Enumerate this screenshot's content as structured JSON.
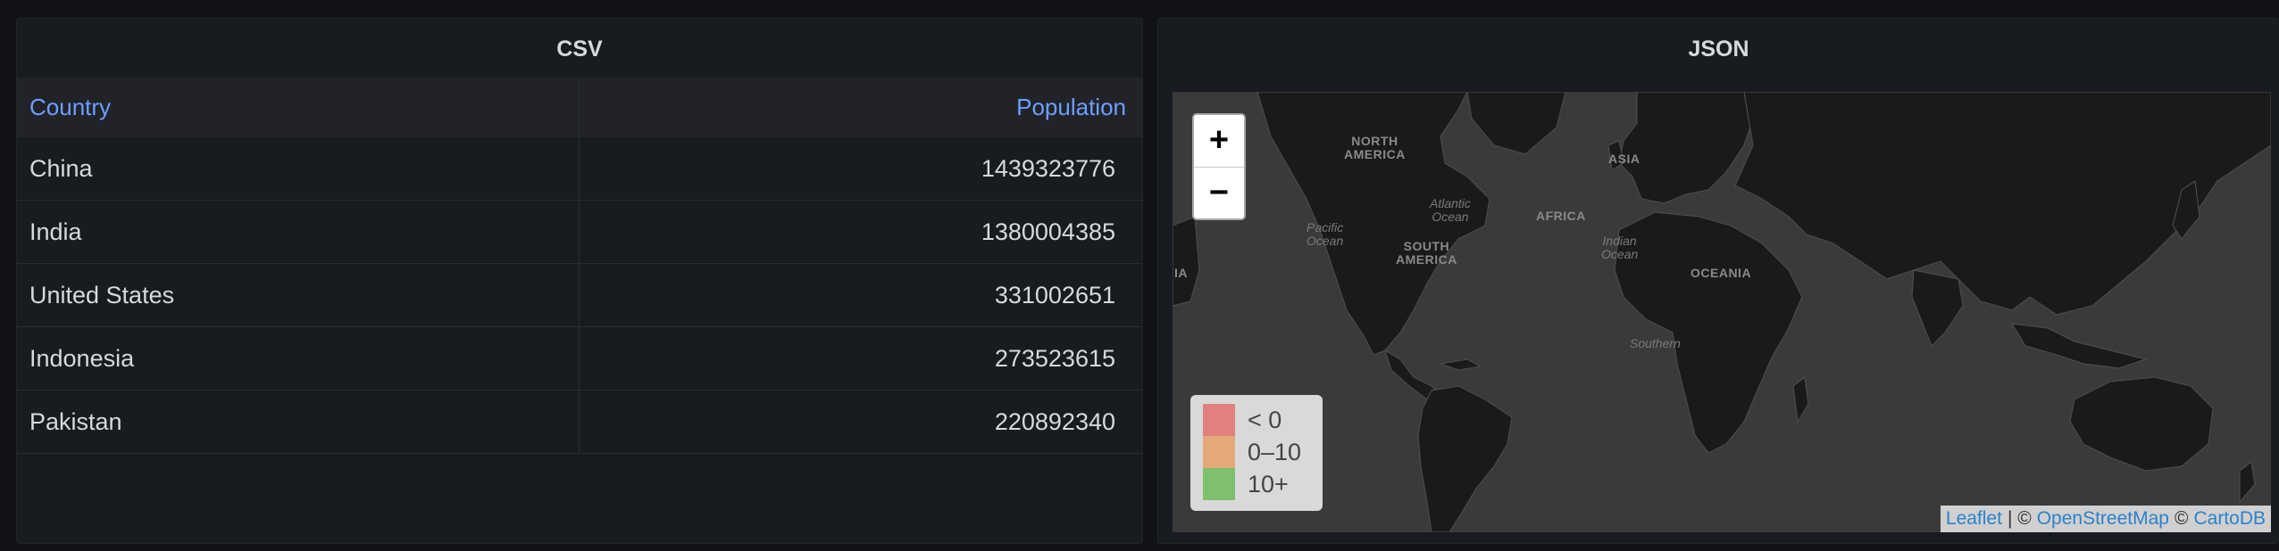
{
  "panels": {
    "csv": {
      "title": "CSV"
    },
    "json": {
      "title": "JSON"
    }
  },
  "table": {
    "columns": [
      "Country",
      "Population"
    ],
    "rows": [
      {
        "country": "China",
        "population": "1439323776"
      },
      {
        "country": "India",
        "population": "1380004385"
      },
      {
        "country": "United States",
        "population": "331002651"
      },
      {
        "country": "Indonesia",
        "population": "273523615"
      },
      {
        "country": "Pakistan",
        "population": "220892340"
      }
    ]
  },
  "map": {
    "zoom_in": "+",
    "zoom_out": "−",
    "continent_labels": {
      "north_america": "NORTH\nAMERICA",
      "south_america": "SOUTH\nAMERICA",
      "africa": "AFRICA",
      "asia": "ASIA",
      "oceania": "OCEANIA",
      "asia_left_fragment": "IA"
    },
    "ocean_labels": {
      "pacific": "Pacific\nOcean",
      "atlantic": "Atlantic\nOcean",
      "indian": "Indian\nOcean",
      "southern": "Southern"
    },
    "legend": [
      {
        "label": "< 0",
        "color": "#e08080"
      },
      {
        "label": "0–10",
        "color": "#e4a87a"
      },
      {
        "label": "10+",
        "color": "#7fbf6f"
      }
    ],
    "attribution": {
      "leaflet": "Leaflet",
      "sep1": "| ©",
      "osm": "OpenStreetMap",
      "sep2": "©",
      "carto": "CartoDB"
    }
  },
  "colors": {
    "background": "#111217",
    "panel": "#181b1f",
    "header_text": "#6e9fff",
    "land": "#1a1a1a",
    "sea": "#3a3a3a"
  }
}
